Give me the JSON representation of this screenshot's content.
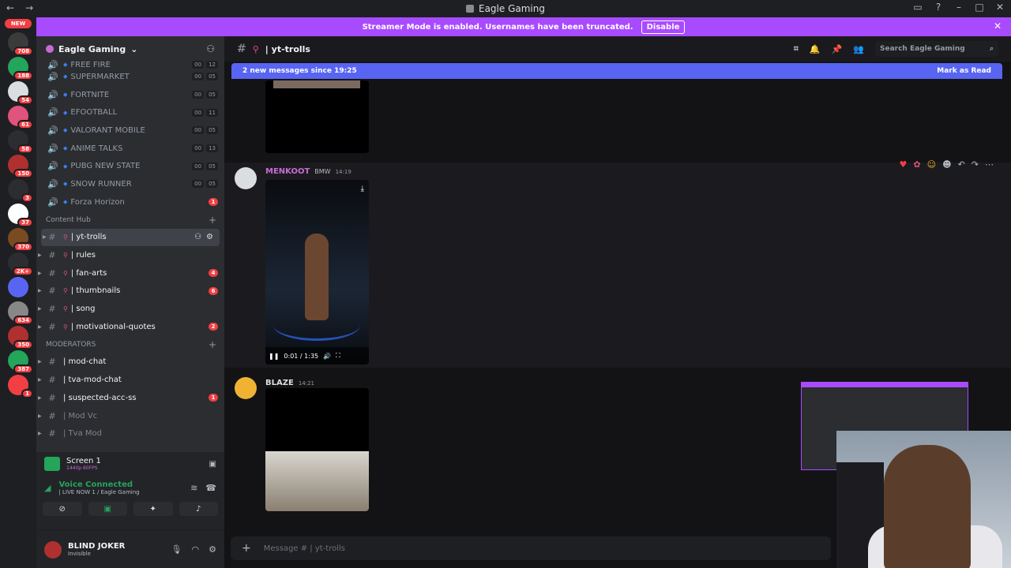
{
  "window": {
    "title": "Eagle Gaming"
  },
  "banner": {
    "text": "Streamer Mode is enabled. Usernames have been truncated.",
    "button": "Disable",
    "color": "#a84bff"
  },
  "servers": [
    {
      "color": "#f23f43",
      "badge": "NEW"
    },
    {
      "color": "#3b3b3b",
      "badge": "708"
    },
    {
      "color": "#23a55a",
      "badge": "188"
    },
    {
      "color": "#dbdee1",
      "badge": "54"
    },
    {
      "color": "#e0537c",
      "badge": "61"
    },
    {
      "color": "#2b2d31",
      "badge": "58"
    },
    {
      "color": "#b03030",
      "badge": "150"
    },
    {
      "color": "#2b2d31",
      "badge": "3"
    },
    {
      "color": "#ffffff",
      "badge": "37"
    },
    {
      "color": "#7a4a20",
      "badge": "370"
    },
    {
      "color": "#2b2d31",
      "badge": "2K+"
    },
    {
      "color": "#5865f2",
      "badge": ""
    },
    {
      "color": "#888888",
      "badge": "634"
    },
    {
      "color": "#b03030",
      "badge": "350"
    },
    {
      "color": "#23a55a",
      "badge": "387"
    },
    {
      "color": "#f23f43",
      "badge": "1"
    }
  ],
  "guild": {
    "name": "Eagle Gaming"
  },
  "voice_channels": [
    {
      "name": "FREE FIRE",
      "counts": [
        "00",
        "12"
      ]
    },
    {
      "name": "SUPERMARKET",
      "counts": [
        "00",
        "05"
      ]
    },
    {
      "name": "FORTNITE",
      "counts": [
        "00",
        "05"
      ]
    },
    {
      "name": "EFOOTBALL",
      "counts": [
        "00",
        "11"
      ]
    },
    {
      "name": "VALORANT MOBILE",
      "counts": [
        "00",
        "05"
      ]
    },
    {
      "name": "ANIME TALKS",
      "counts": [
        "00",
        "13"
      ]
    },
    {
      "name": "PUBG NEW STATE",
      "counts": [
        "00",
        "05"
      ]
    },
    {
      "name": "SNOW RUNNER",
      "counts": [
        "00",
        "05"
      ]
    },
    {
      "name": "Forza Horizon",
      "unread": "1"
    }
  ],
  "content_hub": {
    "label": "Content Hub",
    "channels": [
      {
        "name": "| yt-trolls",
        "unread": ""
      },
      {
        "name": "| rules",
        "unread": ""
      },
      {
        "name": "| fan-arts",
        "unread": "4"
      },
      {
        "name": "| thumbnails",
        "unread": "6"
      },
      {
        "name": "| song",
        "unread": ""
      },
      {
        "name": "| motivational-quotes",
        "unread": "2"
      }
    ]
  },
  "moderators": {
    "label": "MODERATORS",
    "channels": [
      {
        "name": "| mod-chat",
        "unread": ""
      },
      {
        "name": "| tva-mod-chat",
        "unread": ""
      },
      {
        "name": "| suspected-acc-ss",
        "unread": "1"
      },
      {
        "name": "| Mod Vc",
        "unread": ""
      },
      {
        "name": "| Tva Mod",
        "unread": ""
      }
    ]
  },
  "screen_share": {
    "title": "Screen 1",
    "sub": "1440p 60FPS"
  },
  "voice": {
    "status": "Voice Connected",
    "channel": "| LIVE NOW 1 / Eagle Gaming"
  },
  "user": {
    "name": "BLIND JOKER",
    "status": "Invisible"
  },
  "channel_header": {
    "name": "| yt-trolls",
    "search_placeholder": "Search Eagle Gaming"
  },
  "new_messages": {
    "text": "2 new messages since 19:25",
    "action": "Mark as Read"
  },
  "messages": [
    {
      "author": "MENKOOT",
      "tag": "BMW",
      "time": "14:19",
      "author_color": "#c86bd6"
    },
    {
      "author": "BLAZE",
      "time": "14:21",
      "author_color": "#dbdee1"
    }
  ],
  "video": {
    "time": "0:01 / 1:35"
  },
  "composer": {
    "placeholder": "Message # | yt-trolls"
  }
}
